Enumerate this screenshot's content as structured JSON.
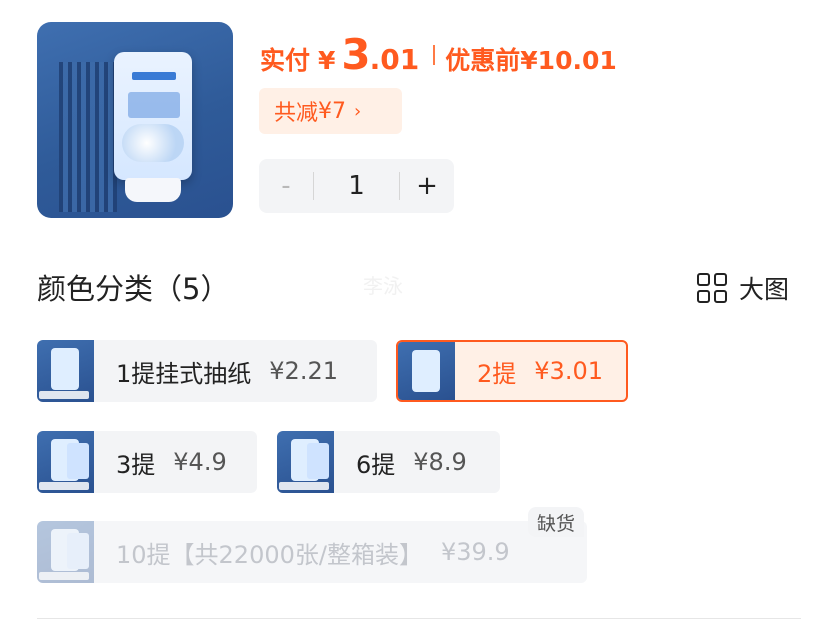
{
  "price": {
    "paid_label": "实付",
    "currency": "¥",
    "paid_int": "3",
    "paid_dec": ".01",
    "before_label": "优惠前",
    "before_value": "¥10.01",
    "accent_color": "#ff5a1f"
  },
  "discount": {
    "label": "共减",
    "amount": "¥7",
    "chevron": "›"
  },
  "quantity": {
    "minus": "-",
    "value": "1",
    "plus": "+"
  },
  "watermark": "李泳",
  "section": {
    "title": "颜色分类（5）",
    "bigview_label": "大图",
    "bigview_icon": "grid-icon"
  },
  "options": [
    {
      "name": "1提挂式抽纸",
      "price": "¥2.21",
      "state": "normal"
    },
    {
      "name": "2提",
      "price": "¥3.01",
      "state": "selected"
    },
    {
      "name": "3提",
      "price": "¥4.9",
      "state": "normal"
    },
    {
      "name": "6提",
      "price": "¥8.9",
      "state": "normal"
    },
    {
      "name": "10提【共22000张/整箱装】",
      "price": "¥39.9",
      "state": "out_of_stock"
    }
  ],
  "out_of_stock_label": "缺货"
}
